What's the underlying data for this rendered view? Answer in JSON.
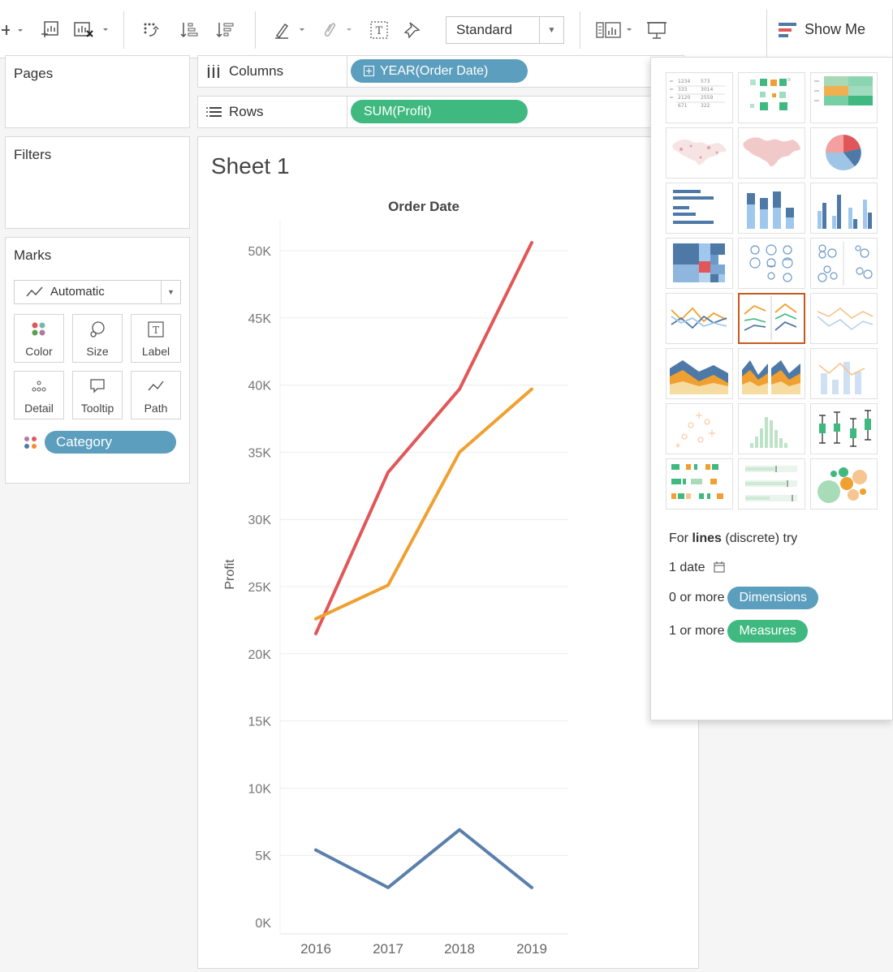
{
  "toolbar": {
    "fit_select": "Standard",
    "show_me_label": "Show Me"
  },
  "panels": {
    "pages": "Pages",
    "filters": "Filters",
    "marks": "Marks",
    "mark_type": "Automatic",
    "mark_buttons": [
      "Color",
      "Size",
      "Label",
      "Detail",
      "Tooltip",
      "Path"
    ],
    "color_field": "Category"
  },
  "shelves": {
    "columns_label": "Columns",
    "columns_pill": "YEAR(Order Date)",
    "rows_label": "Rows",
    "rows_pill": "SUM(Profit)"
  },
  "sheet": {
    "title": "Sheet 1"
  },
  "colors": {
    "dimension_pill": "#5b9ebd",
    "measure_pill": "#3fb97f",
    "selected_border": "#c65a1e"
  },
  "chart_data": {
    "type": "line",
    "title": "Order Date",
    "xlabel": "",
    "ylabel": "Profit",
    "categories": [
      "2016",
      "2017",
      "2018",
      "2019"
    ],
    "ylim": [
      0,
      52000
    ],
    "yticks": [
      "0K",
      "5K",
      "10K",
      "15K",
      "20K",
      "25K",
      "30K",
      "35K",
      "40K",
      "45K",
      "50K"
    ],
    "grid": true,
    "series": [
      {
        "color": "#e15759",
        "values": [
          21500,
          33500,
          39700,
          50600
        ]
      },
      {
        "color": "#f0a030",
        "values": [
          22600,
          25100,
          35000,
          39700
        ]
      },
      {
        "color": "#5b7fad",
        "values": [
          5400,
          2600,
          6900,
          2600
        ]
      }
    ]
  },
  "showme": {
    "hint_prefix": "For ",
    "hint_bold": "lines",
    "hint_suffix": " (discrete) try",
    "req_date": "1 date",
    "req_dim_prefix": "0 or more",
    "req_dim_pill": "Dimensions",
    "req_meas_prefix": "1 or more",
    "req_meas_pill": "Measures"
  }
}
